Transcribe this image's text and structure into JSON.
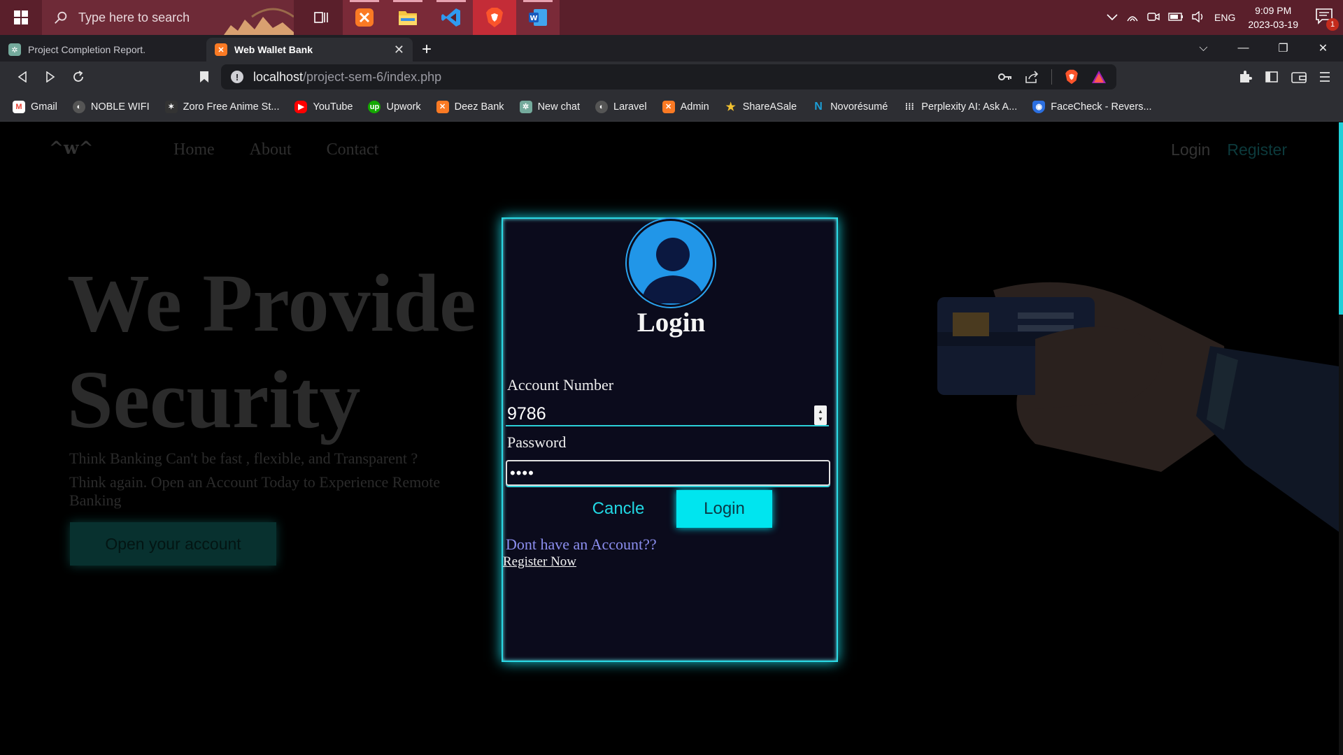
{
  "taskbar": {
    "search_placeholder": "Type here to search",
    "apps": [
      "task-view",
      "xampp",
      "file-explorer",
      "vscode",
      "brave",
      "word"
    ],
    "tray": {
      "language": "ENG",
      "time": "9:09 PM",
      "date": "2023-03-19",
      "notifications": "1"
    }
  },
  "browser": {
    "tabs": [
      {
        "title": "Project Completion Report.",
        "icon": "chatgpt-icon"
      },
      {
        "title": "Web Wallet Bank",
        "icon": "xampp-icon",
        "active": true
      }
    ],
    "url": {
      "host": "localhost",
      "path": "/project-sem-6/index.php"
    },
    "bookmarks": [
      {
        "label": "Gmail",
        "icon": "gmail-icon",
        "color": "#ea4335"
      },
      {
        "label": "NOBLE WIFI",
        "icon": "globe-icon",
        "color": "#555"
      },
      {
        "label": "Zoro Free Anime St...",
        "icon": "zoro-icon",
        "color": "#333"
      },
      {
        "label": "YouTube",
        "icon": "youtube-icon",
        "color": "#ff0000"
      },
      {
        "label": "Upwork",
        "icon": "upwork-icon",
        "color": "#14a800"
      },
      {
        "label": "Deez Bank",
        "icon": "xampp-icon",
        "color": "#fb7a24"
      },
      {
        "label": "New chat",
        "icon": "chatgpt-icon",
        "color": "#74aa9c"
      },
      {
        "label": "Laravel",
        "icon": "globe-icon",
        "color": "#555"
      },
      {
        "label": "Admin",
        "icon": "xampp-icon",
        "color": "#fb7a24"
      },
      {
        "label": "ShareASale",
        "icon": "star-icon",
        "color": "#d9a520"
      },
      {
        "label": "Novorésumé",
        "icon": "novoresume-icon",
        "color": "#1c7ed6"
      },
      {
        "label": "Perplexity AI: Ask A...",
        "icon": "grid-icon",
        "color": "#444"
      },
      {
        "label": "FaceCheck - Revers...",
        "icon": "shield-icon",
        "color": "#2b6fe0"
      }
    ]
  },
  "site": {
    "logo": "^w^",
    "nav": [
      "Home",
      "About",
      "Contact"
    ],
    "auth": {
      "login": "Login",
      "register": "Register"
    },
    "hero": {
      "title": "We Provide Security",
      "line1": "Think Banking Can't be fast , flexible, and Transparent ?",
      "line2": "Think again. Open an Account Today to Experience Remote Banking",
      "cta": "Open your account"
    }
  },
  "modal": {
    "title": "Login",
    "account_label": "Account Number",
    "account_value": "9786",
    "password_label": "Password",
    "password_value": "••••",
    "cancel_label": "Cancle",
    "login_label": "Login",
    "no_account_text": "Dont have an Account??",
    "register_link": "Register Now"
  },
  "colors": {
    "accent": "#2bd8e4",
    "login_button": "#00e5ef",
    "avatar": "#2196e8",
    "taskbar": "#5a1f2b"
  }
}
